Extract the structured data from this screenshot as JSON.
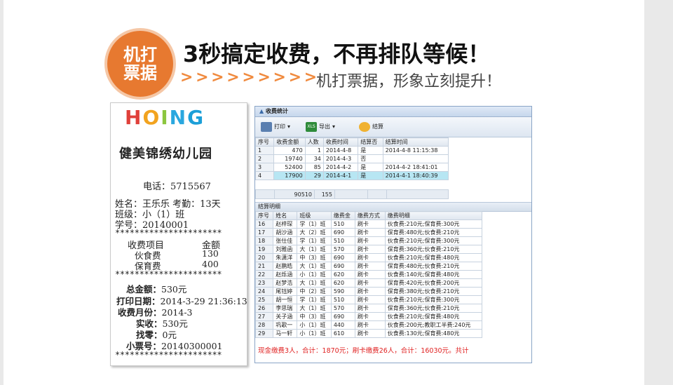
{
  "badge": {
    "line1": "机打",
    "line2": "票据"
  },
  "headline": "3秒搞定收费，不再排队等候！",
  "chevrons": "> > > > > > > > >",
  "subline": "机打票据，形象立刻提升！",
  "receipt": {
    "logo": [
      "H",
      "O",
      "I",
      "N",
      "G"
    ],
    "school": "健美锦绣幼儿园",
    "phone": "电话：5715567",
    "name_line": "姓名：王乐乐  考勤：13天",
    "class_line": "班级：小（1）班",
    "id_line": "学号：20140001",
    "stars": "**********************",
    "items_header": [
      "收费项目",
      "金额"
    ],
    "items": [
      [
        "伙食费",
        "130"
      ],
      [
        "保育费",
        "400"
      ]
    ],
    "total_label": "总金额：",
    "total": "530元",
    "print_date_label": "打印日期：",
    "print_date": "2014-3-29 21:36:13",
    "month_label": "收费月份：",
    "month": "2014-3",
    "paid_label": "实收：",
    "paid": "530元",
    "change_label": "找零：",
    "change": "0元",
    "ticket_label": "小票号：",
    "ticket": "20140300001"
  },
  "window": {
    "title": "收费统计",
    "toolbar": {
      "print": "打印",
      "export": "导出",
      "settle": "结算"
    },
    "table1": {
      "headers": [
        "序号",
        "收费金额",
        "人数",
        "收费时间",
        "结算否",
        "结算时间"
      ],
      "rows": [
        [
          "1",
          "470",
          "1",
          "2014-4-8",
          "是",
          "2014-4-8 11:15:38"
        ],
        [
          "2",
          "19740",
          "34",
          "2014-4-3",
          "否",
          ""
        ],
        [
          "3",
          "52400",
          "85",
          "2014-4-2",
          "是",
          "2014-4-2 18:41:01"
        ],
        [
          "4",
          "17900",
          "29",
          "2014-4-1",
          "是",
          "2014-4-1 18:40:39"
        ]
      ],
      "summary": [
        "",
        "90510",
        "155",
        "",
        "",
        ""
      ]
    },
    "section_title": "结算明细",
    "table2": {
      "headers": [
        "序号",
        "姓名",
        "班级",
        "缴费金",
        "缴费方式",
        "缴费明细"
      ],
      "rows": [
        [
          "16",
          "赵梓琛",
          "学（1）班",
          "510",
          "刷卡",
          "伙食费:210元;保育费:300元"
        ],
        [
          "17",
          "胡沙涵",
          "大（2）班",
          "690",
          "刷卡",
          "保育费:480元;伙食费:210元"
        ],
        [
          "18",
          "张仕佳",
          "学（1）班",
          "510",
          "刷卡",
          "伙食费:210元;保育费:300元"
        ],
        [
          "19",
          "刘雅函",
          "大（1）班",
          "570",
          "刷卡",
          "保育费:360元;伙食费:210元"
        ],
        [
          "20",
          "朱潇洋",
          "中（3）班",
          "690",
          "刷卡",
          "伙食费:210元;保育费:480元"
        ],
        [
          "21",
          "赵鹏皓",
          "大（1）班",
          "690",
          "刷卡",
          "保育费:480元;伙食费:210元"
        ],
        [
          "22",
          "赵烁涵",
          "小（1）班",
          "620",
          "刷卡",
          "伙食费:140元;保育费:480元"
        ],
        [
          "23",
          "赵梦浩",
          "大（1）班",
          "620",
          "刷卡",
          "保育费:420元;伙食费:200元"
        ],
        [
          "24",
          "尾钰婷",
          "中（2）班",
          "590",
          "刷卡",
          "保育费:380元;伙食费:210元"
        ],
        [
          "25",
          "胡一恒",
          "学（1）班",
          "510",
          "刷卡",
          "伙食费:210元;保育费:300元"
        ],
        [
          "26",
          "李思瑞",
          "大（1）班",
          "570",
          "刷卡",
          "保育费:360元;伙食费:210元"
        ],
        [
          "27",
          "关子涵",
          "中（3）班",
          "690",
          "刷卡",
          "伙食费:210元;保育费:480元"
        ],
        [
          "28",
          "巩歌一",
          "小（1）班",
          "440",
          "刷卡",
          "伙食费:200元;教职工半费:240元"
        ],
        [
          "29",
          "马一轩",
          "小（1）班",
          "610",
          "刷卡",
          "伙食费:130元;保育费:480元"
        ]
      ]
    },
    "footer": "现金缴费3人，合计：1870元；刷卡缴费26人，合计：16030元。共计"
  },
  "colors": {
    "accent": "#e77930",
    "selected_row": "#b7e6f3",
    "footer_text": "#e02020"
  }
}
